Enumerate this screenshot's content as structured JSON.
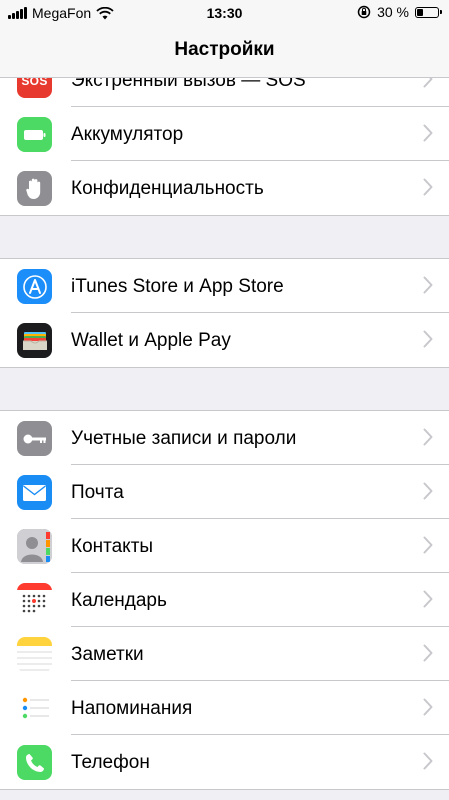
{
  "status_bar": {
    "carrier": "MegaFon",
    "time": "13:30",
    "battery_percent": "30 %",
    "battery_level": 0.3
  },
  "nav": {
    "title": "Настройки"
  },
  "groups": [
    {
      "items": [
        {
          "label": "Экстренный вызов — SOS",
          "icon": "sos-icon",
          "icon_text": "SOS",
          "color": "#e8392f"
        },
        {
          "label": "Аккумулятор",
          "icon": "battery-icon",
          "color": "#4cd964"
        },
        {
          "label": "Конфиденциальность",
          "icon": "hand-icon",
          "color": "#8e8e93"
        }
      ]
    },
    {
      "items": [
        {
          "label": "iTunes Store и App Store",
          "icon": "app-store-icon",
          "color": "#1c8ef9"
        },
        {
          "label": "Wallet и Apple Pay",
          "icon": "wallet-icon",
          "color": "#1c1c1e"
        }
      ]
    },
    {
      "items": [
        {
          "label": "Учетные записи и пароли",
          "icon": "key-icon",
          "color": "#8e8e93"
        },
        {
          "label": "Почта",
          "icon": "mail-icon",
          "color": "#1a8df5"
        },
        {
          "label": "Контакты",
          "icon": "contacts-icon",
          "color": "#a2a2a7"
        },
        {
          "label": "Календарь",
          "icon": "calendar-icon",
          "color": "#ffffff"
        },
        {
          "label": "Заметки",
          "icon": "notes-icon",
          "color": "#ffffff"
        },
        {
          "label": "Напоминания",
          "icon": "reminders-icon",
          "color": "#ffffff"
        },
        {
          "label": "Телефон",
          "icon": "phone-icon",
          "color": "#4cd964"
        }
      ]
    }
  ]
}
